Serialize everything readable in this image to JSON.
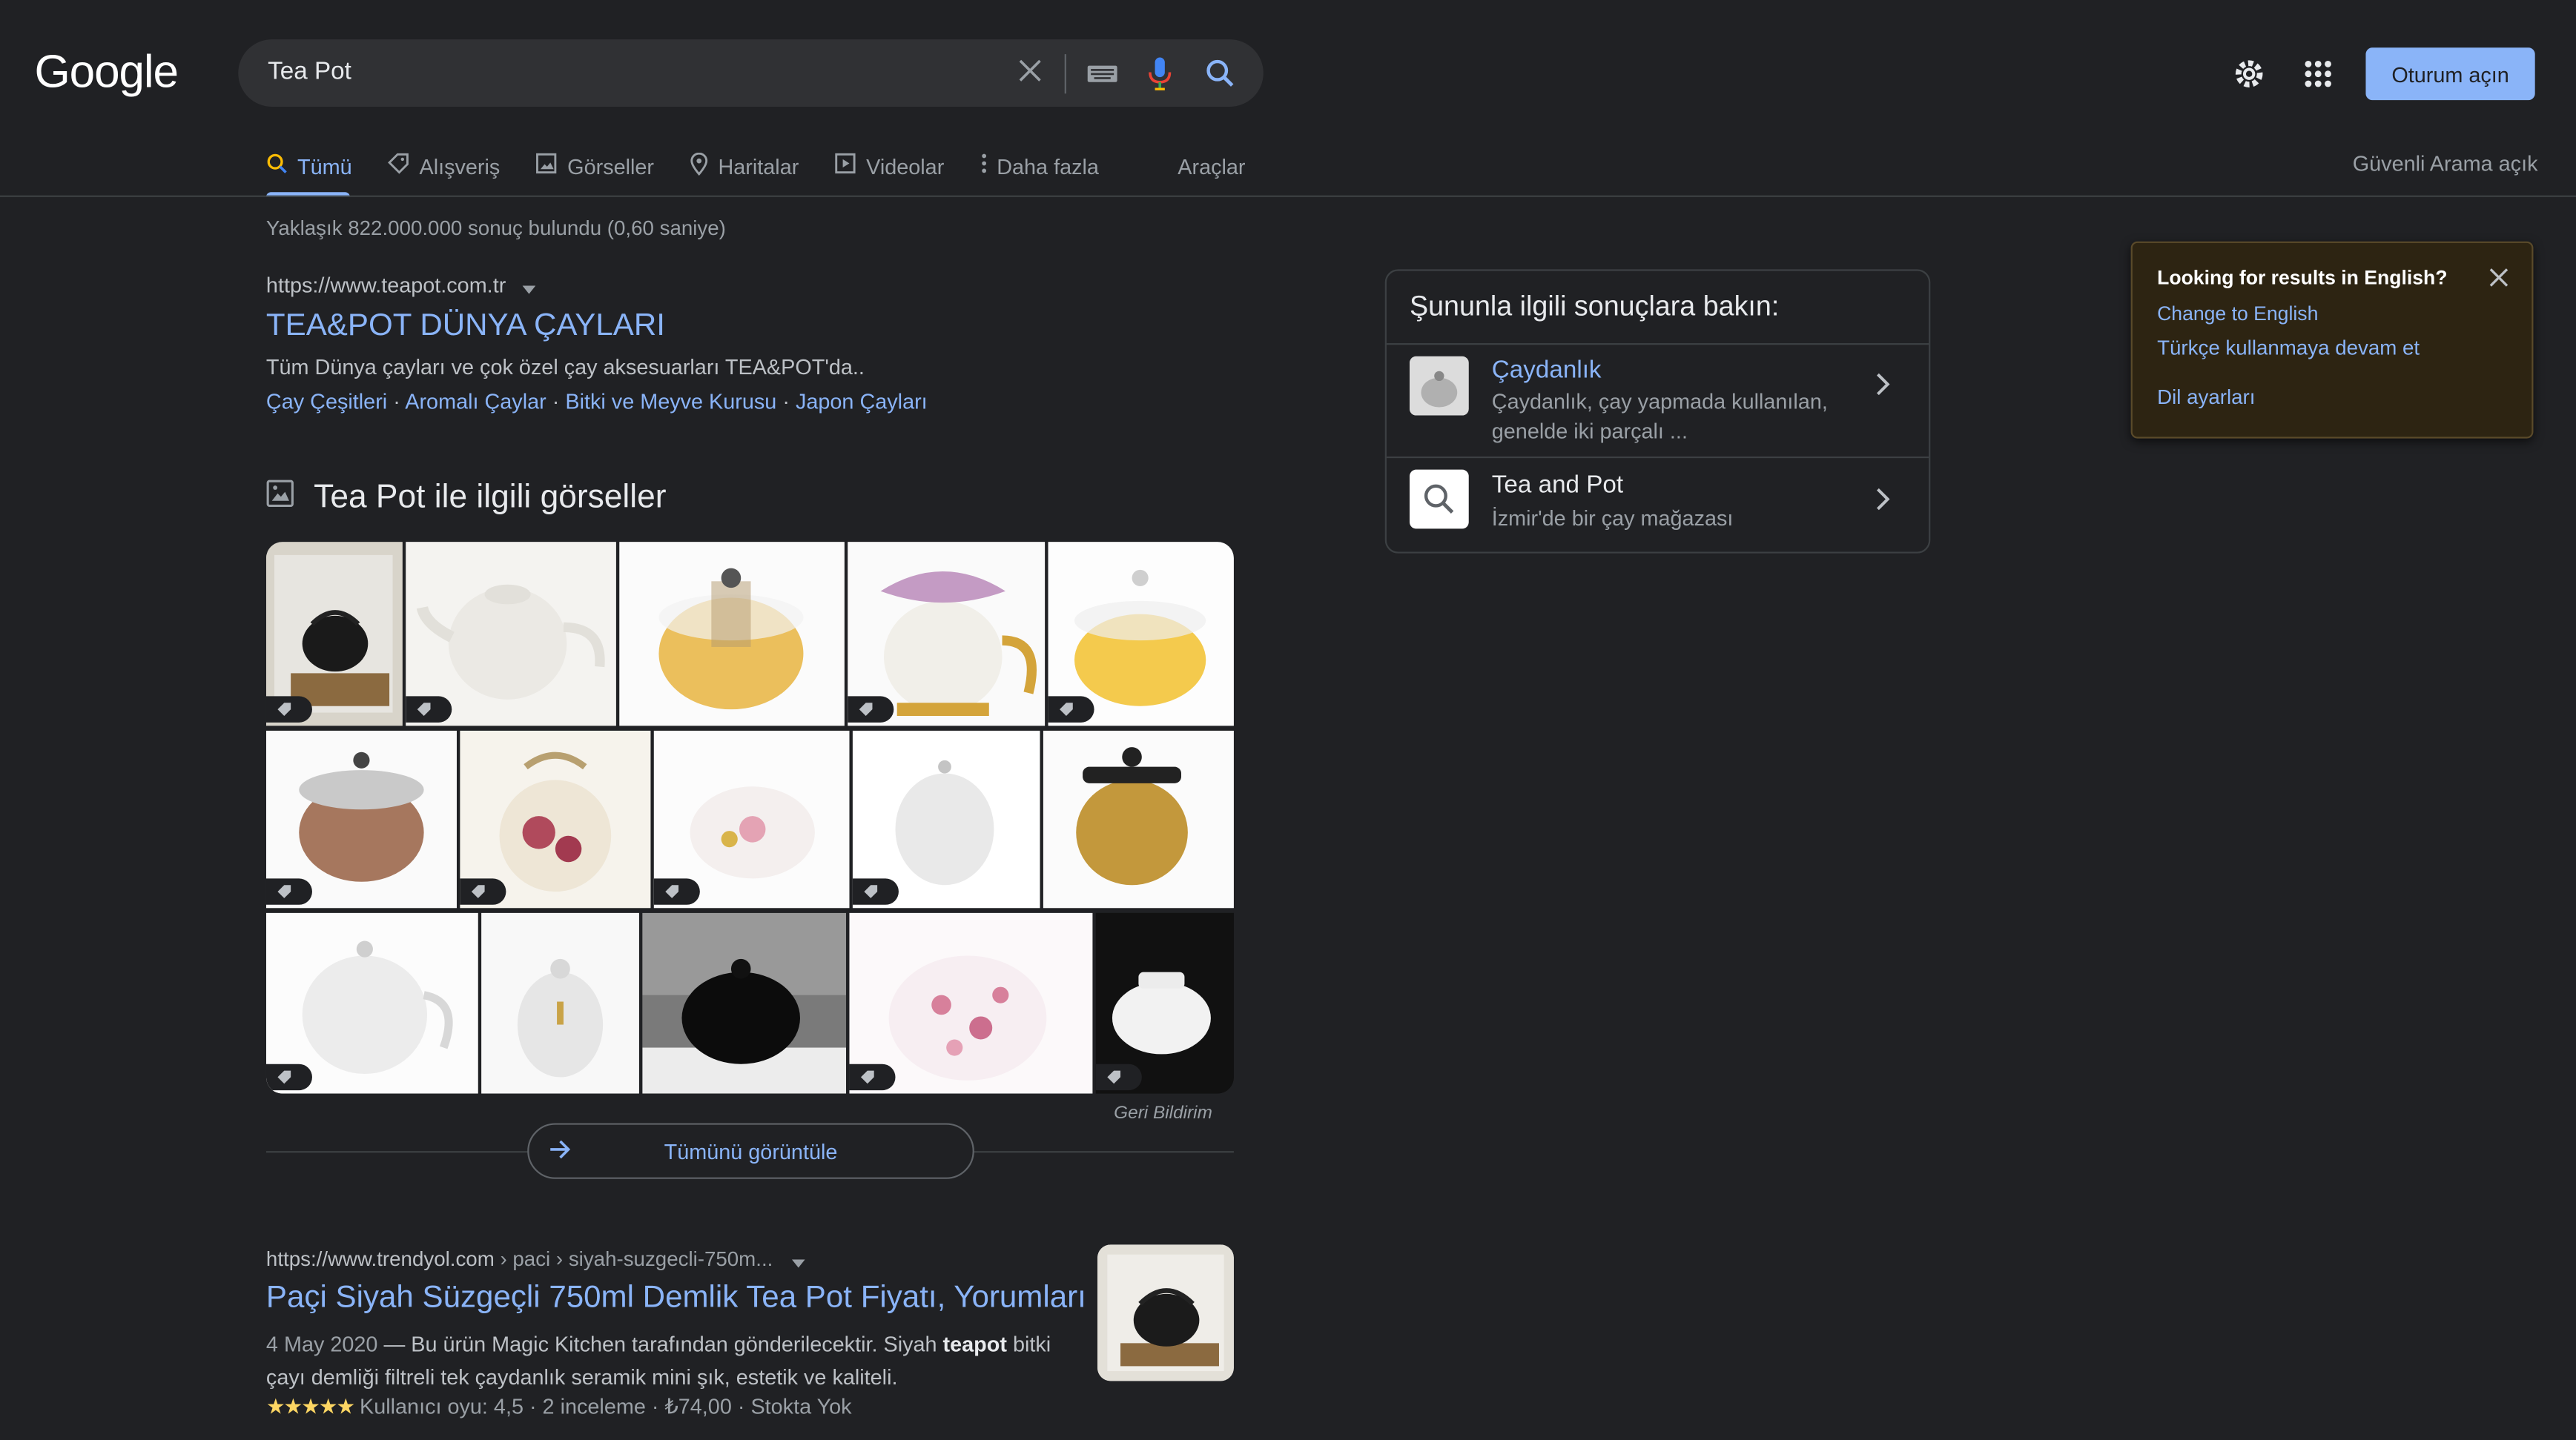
{
  "header": {
    "logo": "Google",
    "query": "Tea Pot",
    "signin_label": "Oturum açın"
  },
  "tabs": {
    "all": "Tümü",
    "shopping": "Alışveriş",
    "images": "Görseller",
    "maps": "Haritalar",
    "videos": "Videolar",
    "more": "Daha fazla",
    "tools": "Araçlar",
    "safe_search": "Güvenli Arama açık"
  },
  "stats": "Yaklaşık 822.000.000 sonuç bulundu (0,60 saniye)",
  "result1": {
    "url": "https://www.teapot.com.tr",
    "title": "TEA&POT DÜNYA ÇAYLARI",
    "desc": "Tüm Dünya çayları ve çok özel çay aksesuarları TEA&POT'da..",
    "sitelinks": [
      "Çay Çeşitleri",
      "Aromalı Çaylar",
      "Bitki ve Meyve Kurusu",
      "Japon Çayları"
    ]
  },
  "images_section": {
    "heading": "Tea Pot ile ilgili görseller",
    "feedback": "Geri Bildirim",
    "view_all": "Tümünü görüntüle"
  },
  "result2": {
    "url": "https://www.trendyol.com",
    "breadcrumb": " › paci › siyah-suzgecli-750m...",
    "title": "Paçi Siyah Süzgeçli 750ml Demlik Tea Pot Fiyatı, Yorumları",
    "date": "4 May 2020",
    "desc_before": " — Bu ürün Magic Kitchen tarafından gönderilecektir. Siyah ",
    "desc_bold": "teapot",
    "desc_after": " bitki çayı demliği filtreli tek çaydanlık seramik mini şık, estetik ve kaliteli.",
    "stars": "★★★★★",
    "rating": "Kullanıcı oyu: 4,5 · 2 inceleme · ₺74,00 · Stokta Yok"
  },
  "related_panel": {
    "title": "Şununla ilgili sonuçlara bakın:",
    "items": [
      {
        "title": "Çaydanlık",
        "sub": "Çaydanlık, çay yapmada kullanılan, genelde iki parçalı ..."
      },
      {
        "title": "Tea and Pot",
        "sub": "İzmir'de bir çay mağazası"
      }
    ]
  },
  "language_box": {
    "title": "Looking for results in English?",
    "change": "Change to English",
    "keep": "Türkçe kullanmaya devam et",
    "settings": "Dil ayarları"
  },
  "colors": {
    "background": "#202124",
    "link": "#8ab4f8",
    "signin_bg": "#8ab4f8"
  }
}
